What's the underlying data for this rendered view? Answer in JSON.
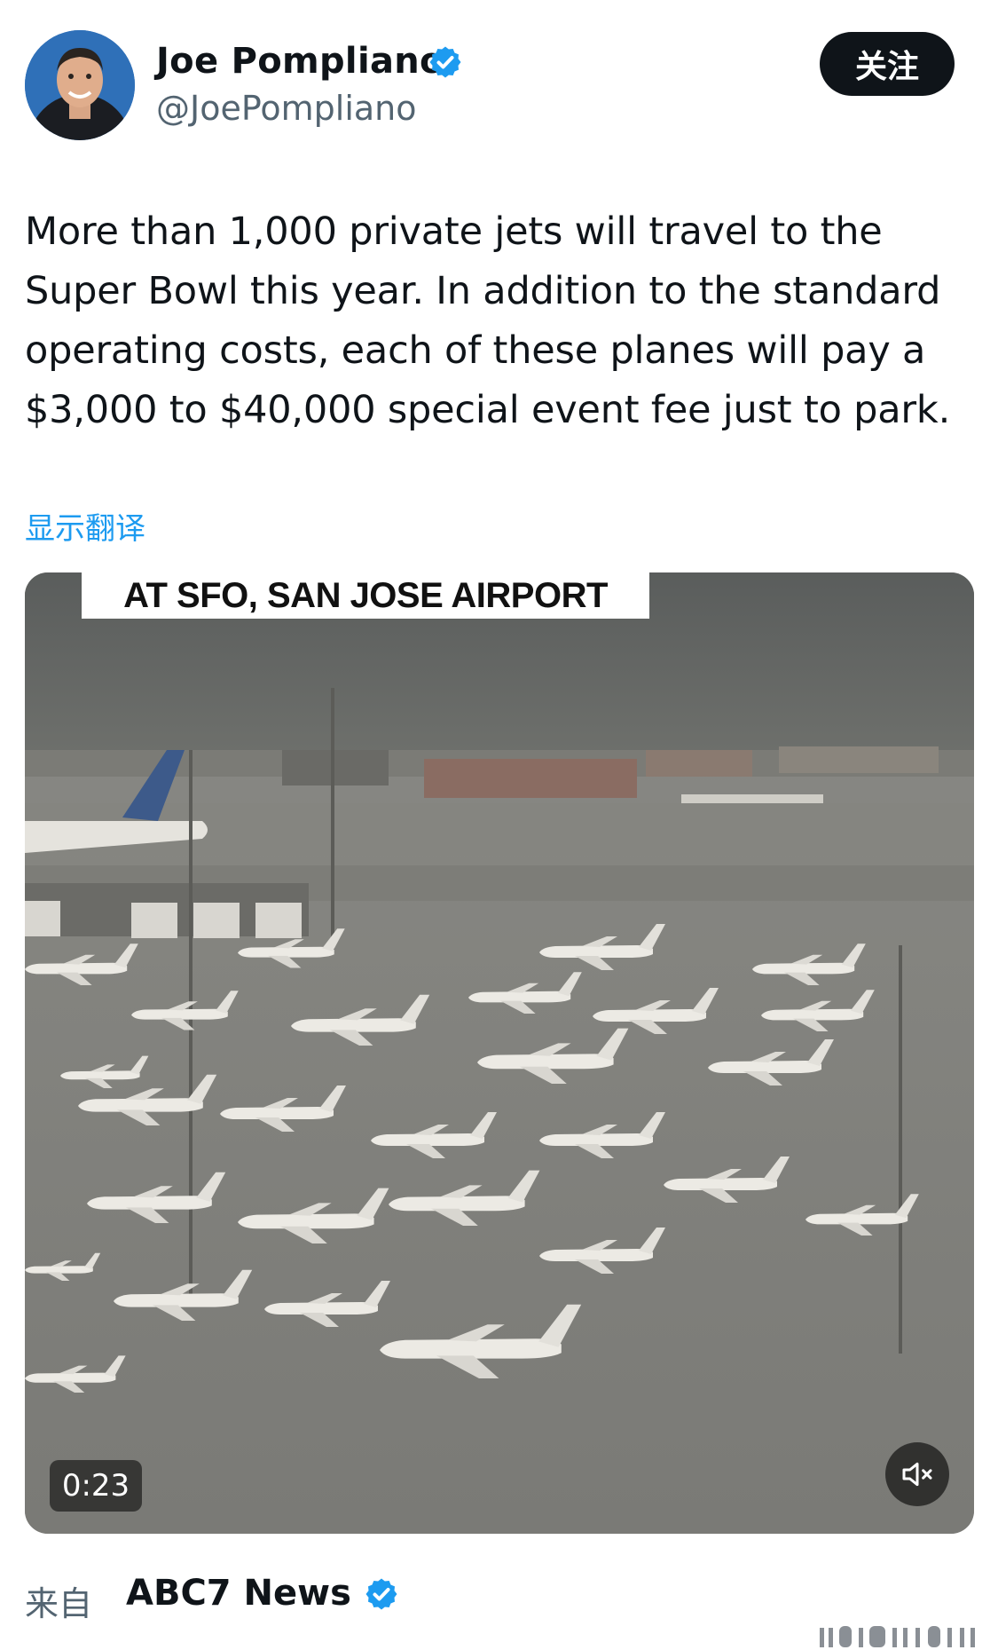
{
  "author": {
    "name": "Joe Pompliano",
    "handle": "@JoePompliano",
    "verified": true,
    "avatar_icon": "profile-photo"
  },
  "follow_button": {
    "label": "关注"
  },
  "tweet": {
    "text": "More than 1,000 private jets will travel to the\nSuper Bowl this year. In addition to the standard\noperating costs, each of these planes will pay a\n$3,000 to $40,000 special event fee just to park."
  },
  "translate": {
    "label": "显示翻译"
  },
  "media": {
    "type": "video",
    "caption": "AT SFO, SAN JOSE AIRPORT",
    "duration": "0:23",
    "muted": true,
    "mute_icon": "speaker-muted-icon"
  },
  "source": {
    "prefix": "来自",
    "name": "ABC7 News",
    "verified": true
  },
  "colors": {
    "accent": "#1d9bf0",
    "text": "#0f1419",
    "secondary": "#536471",
    "button_bg": "#0f1419"
  }
}
